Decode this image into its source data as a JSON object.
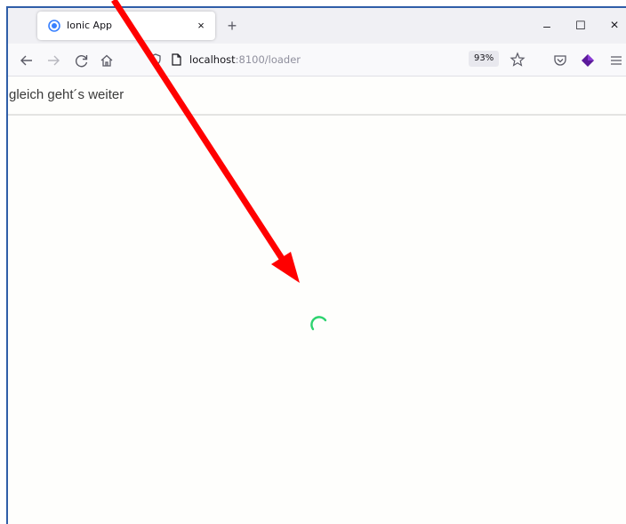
{
  "browser": {
    "tab": {
      "title": "Ionic App",
      "close_glyph": "×",
      "favicon_icon": "ionic-logo-icon",
      "accent_color": "#3880ff"
    },
    "new_tab_glyph": "+",
    "window_controls": {
      "minimize_glyph": "–",
      "maximize_glyph": "☐",
      "close_glyph": "×"
    },
    "nav": {
      "back_icon": "back-arrow-icon",
      "forward_icon": "forward-arrow-icon",
      "reload_icon": "reload-icon",
      "home_icon": "home-icon"
    },
    "url": {
      "host": "localhost",
      "rest": ":8100/loader",
      "zoom": "93%"
    },
    "toolbar_icons": [
      "shield-icon",
      "page-icon",
      "bookmark-star-icon",
      "pocket-icon",
      "extension-icon",
      "menu-icon"
    ]
  },
  "app": {
    "header_title": "gleich geht´s weiter",
    "spinner_color": "#2dd36f"
  },
  "annotation": {
    "arrow_color": "#ff0000"
  }
}
